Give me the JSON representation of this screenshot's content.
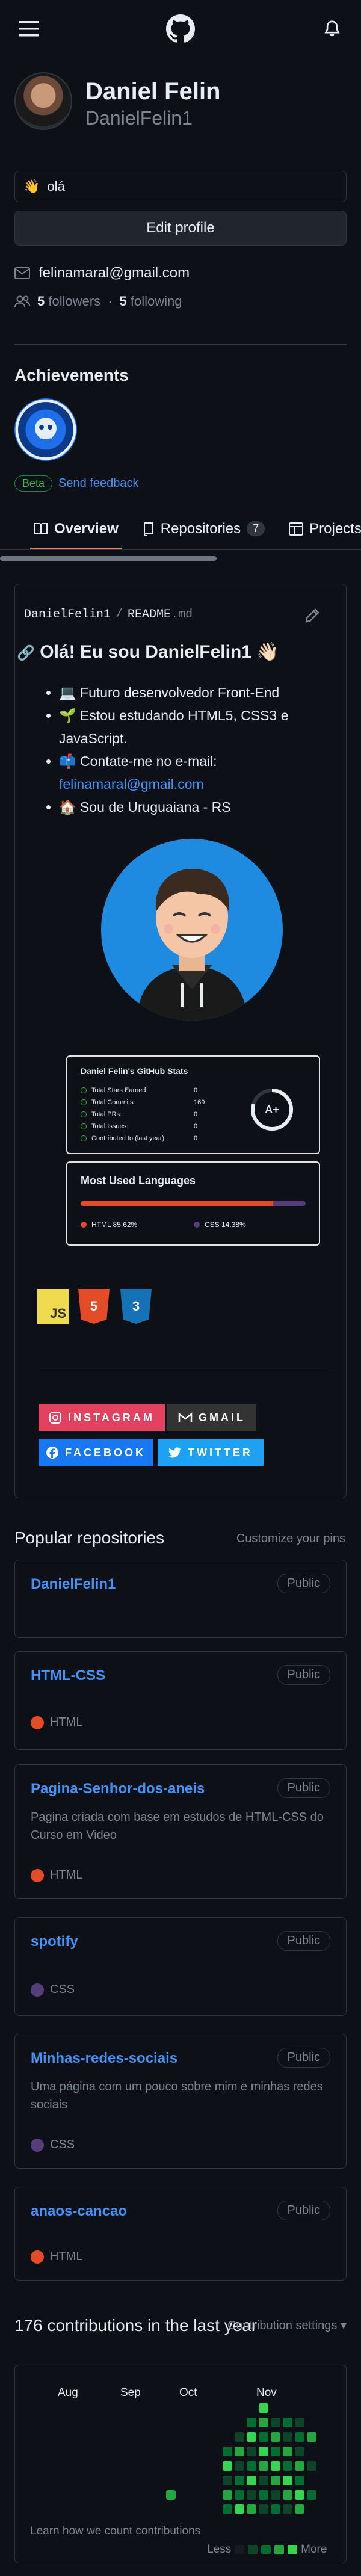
{
  "header": {
    "menu_icon": "hamburger-icon",
    "logo_icon": "github-logo-icon",
    "notification_icon": "bell-icon"
  },
  "profile": {
    "name": "Daniel Felin",
    "login": "DanielFelin1",
    "status_emoji": "👋",
    "status_text": "olá",
    "edit_label": "Edit profile",
    "email": "felinamaral@gmail.com",
    "followers_count": "5",
    "followers_label": "followers",
    "separator": "·",
    "following_count": "5",
    "following_label": "following"
  },
  "achievements": {
    "title": "Achievements",
    "beta_label": "Beta",
    "feedback_label": "Send feedback"
  },
  "tabs": [
    {
      "label": "Overview",
      "icon": "book-icon"
    },
    {
      "label": "Repositories",
      "icon": "repo-icon",
      "count": "7"
    },
    {
      "label": "Projects",
      "icon": "table-icon"
    }
  ],
  "readme": {
    "path_user": "DanielFelin1",
    "path_sep": "/",
    "path_file": "README",
    "path_ext": ".md",
    "greeting": "Olá! Eu sou DanielFelin1 👋🏻",
    "bullets": [
      "💻 Futuro desenvolvedor Front-End",
      "🌱 Estou estudando HTML5, CSS3 e JavaScript.",
      "📫 Contate-me no e-mail:",
      "🏠 Sou de Uruguaiana - RS"
    ],
    "email_link": "felinamaral@gmail.com"
  },
  "stats_card": {
    "title": "Daniel Felin's GitHub Stats",
    "rows": [
      {
        "label": "Total Stars Earned:",
        "value": "0"
      },
      {
        "label": "Total Commits:",
        "value": "169"
      },
      {
        "label": "Total PRs:",
        "value": "0"
      },
      {
        "label": "Total Issues:",
        "value": "0"
      },
      {
        "label": "Contributed to (last year):",
        "value": "0"
      }
    ],
    "grade": "A+"
  },
  "langs_card": {
    "title": "Most Used Languages",
    "items": [
      {
        "label": "HTML 85.62%",
        "percent": 85.62,
        "color": "#e34c26"
      },
      {
        "label": "CSS 14.38%",
        "percent": 14.38,
        "color": "#563d7c"
      }
    ]
  },
  "tech_icons": [
    {
      "label": "JS",
      "name": "javascript-icon"
    },
    {
      "label": "5",
      "name": "html5-icon"
    },
    {
      "label": "3",
      "name": "css3-icon"
    }
  ],
  "social": [
    {
      "label": "INSTAGRAM",
      "icon": "instagram-icon",
      "color": "#e4405f"
    },
    {
      "label": "GMAIL",
      "icon": "gmail-icon",
      "color": "#333333"
    },
    {
      "label": "FACEBOOK",
      "icon": "facebook-icon",
      "color": "#1877f2"
    },
    {
      "label": "TWITTER",
      "icon": "twitter-icon",
      "color": "#1da1f2"
    }
  ],
  "popular": {
    "title": "Popular repositories",
    "customize_label": "Customize your pins",
    "repos": [
      {
        "name": "DanielFelin1",
        "visibility": "Public",
        "description": "",
        "language": ""
      },
      {
        "name": "HTML-CSS",
        "visibility": "Public",
        "description": "",
        "language": "HTML"
      },
      {
        "name": "Pagina-Senhor-dos-aneis",
        "visibility": "Public",
        "description": "Pagina criada com base em estudos de HTML-CSS do Curso em Video",
        "language": "HTML"
      },
      {
        "name": "spotify",
        "visibility": "Public",
        "description": "",
        "language": "CSS"
      },
      {
        "name": "Minhas-redes-sociais",
        "visibility": "Public",
        "description": "Uma página com um pouco sobre mim e minhas redes sociais",
        "language": "CSS"
      },
      {
        "name": "anaos-cancao",
        "visibility": "Public",
        "description": "",
        "language": "HTML"
      }
    ]
  },
  "contributions": {
    "title": "176 contributions in the last year",
    "settings_label": "Contribution settings ▾",
    "months": [
      "Aug",
      "Sep",
      "Oct",
      "Nov"
    ],
    "learn_label": "Learn how we count contributions",
    "less_label": "Less",
    "more_label": "More"
  },
  "colors": {
    "accent": "#f78166",
    "link": "#4493f8",
    "html": "#e34c26",
    "css": "#563d7c",
    "green": "#3fb950"
  }
}
